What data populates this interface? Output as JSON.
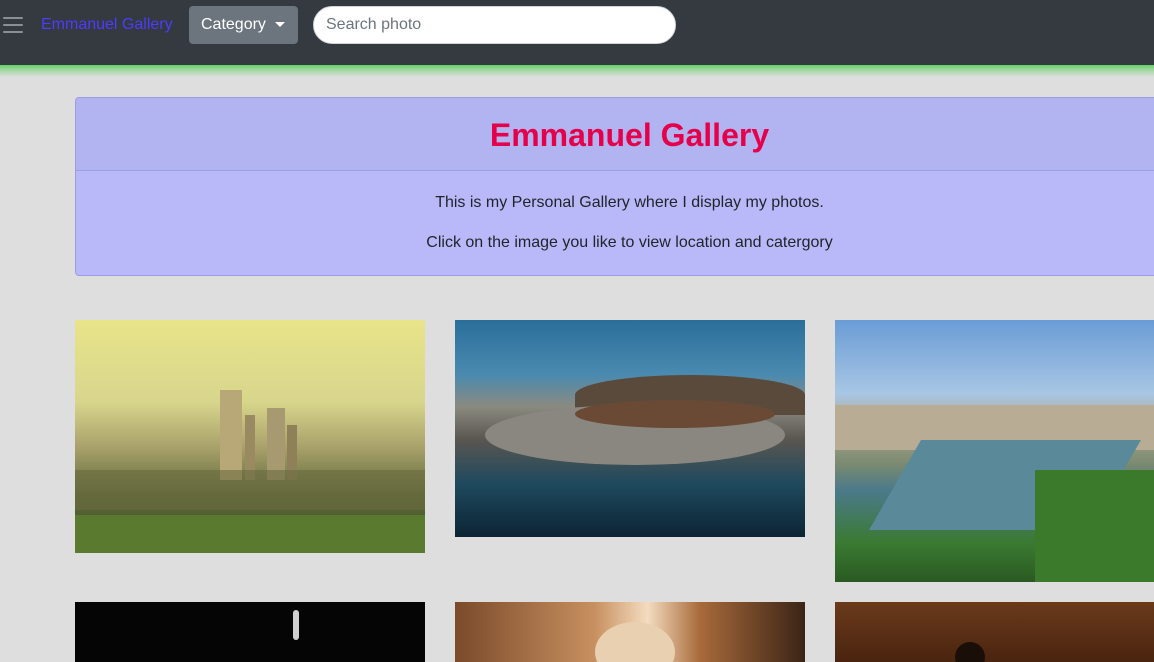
{
  "navbar": {
    "menu_icon": "hamburger-menu-icon",
    "brand": "Emmanuel Gallery",
    "category_label": "Category",
    "category_icon": "caret-down-icon",
    "search_placeholder": "Search photo",
    "search_value": ""
  },
  "intro_card": {
    "title": "Emmanuel Gallery",
    "line1": "This is my Personal Gallery where I display my photos.",
    "line2": "Click on the image you like to view location and catergory"
  },
  "photos": [
    {
      "subject": "city-skyline-photo"
    },
    {
      "subject": "aerial-coastal-city-photo"
    },
    {
      "subject": "river-city-photo"
    },
    {
      "subject": "dark-photo"
    },
    {
      "subject": "coffee-cup-photo"
    },
    {
      "subject": "wooden-surface-photo"
    }
  ],
  "colors": {
    "navbar_bg": "#343a40",
    "brand": "#4d3bff",
    "title": "#e6004c",
    "card_bg": "#b9b9fa",
    "page_bg": "#dedede",
    "accent_glow": "#5fd35f"
  }
}
